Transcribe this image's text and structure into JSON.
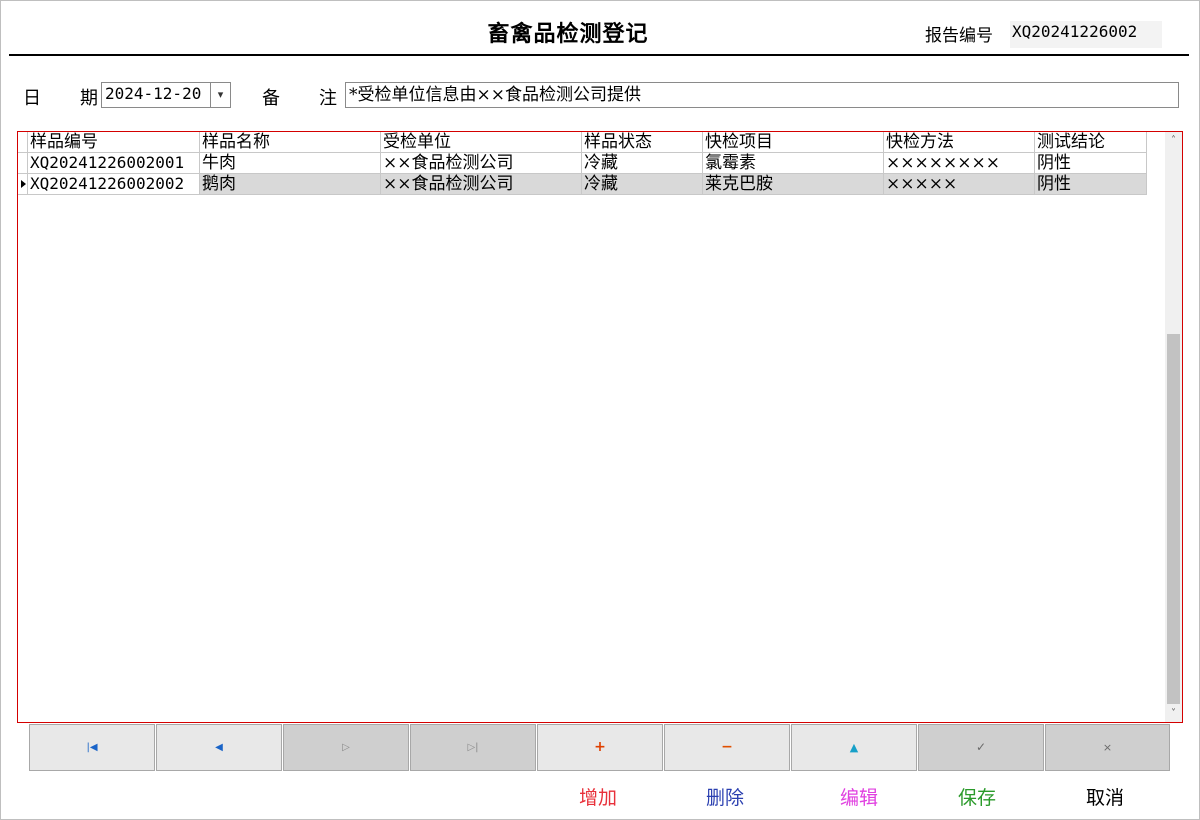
{
  "header": {
    "title": "畜禽品检测登记",
    "report_label": "报告编号",
    "report_no": "XQ20241226002"
  },
  "form": {
    "date_label_1": "日",
    "date_label_2": "期",
    "date_value": "2024-12-20",
    "remark_label_1": "备",
    "remark_label_2": "注",
    "remark_value": "*受检单位信息由××食品检测公司提供"
  },
  "grid": {
    "columns": [
      "样品编号",
      "样品名称",
      "受检单位",
      "样品状态",
      "快检项目",
      "快检方法",
      "测试结论"
    ],
    "rows": [
      [
        "XQ20241226002001",
        "牛肉",
        "××食品检测公司",
        "冷藏",
        "氯霉素",
        "××××××××",
        "阴性"
      ],
      [
        "XQ20241226002002",
        "鹅肉",
        "××食品检测公司",
        "冷藏",
        "莱克巴胺",
        "×××××",
        "阴性"
      ]
    ],
    "selected_row": 2
  },
  "nav_icons": [
    "first-record-icon",
    "prev-record-icon",
    "next-record-icon",
    "last-record-icon",
    "add-icon",
    "delete-icon",
    "edit-icon",
    "save-icon",
    "cancel-icon"
  ],
  "actions": {
    "add": "增加",
    "delete": "删除",
    "edit": "编辑",
    "save": "保存",
    "cancel": "取消"
  },
  "colors": {
    "add": "#e8303a",
    "delete": "#2a3fb0",
    "edit": "#e040e0",
    "save": "#2a9a2a",
    "cancel": "#000000",
    "grid_border": "#d40000"
  }
}
